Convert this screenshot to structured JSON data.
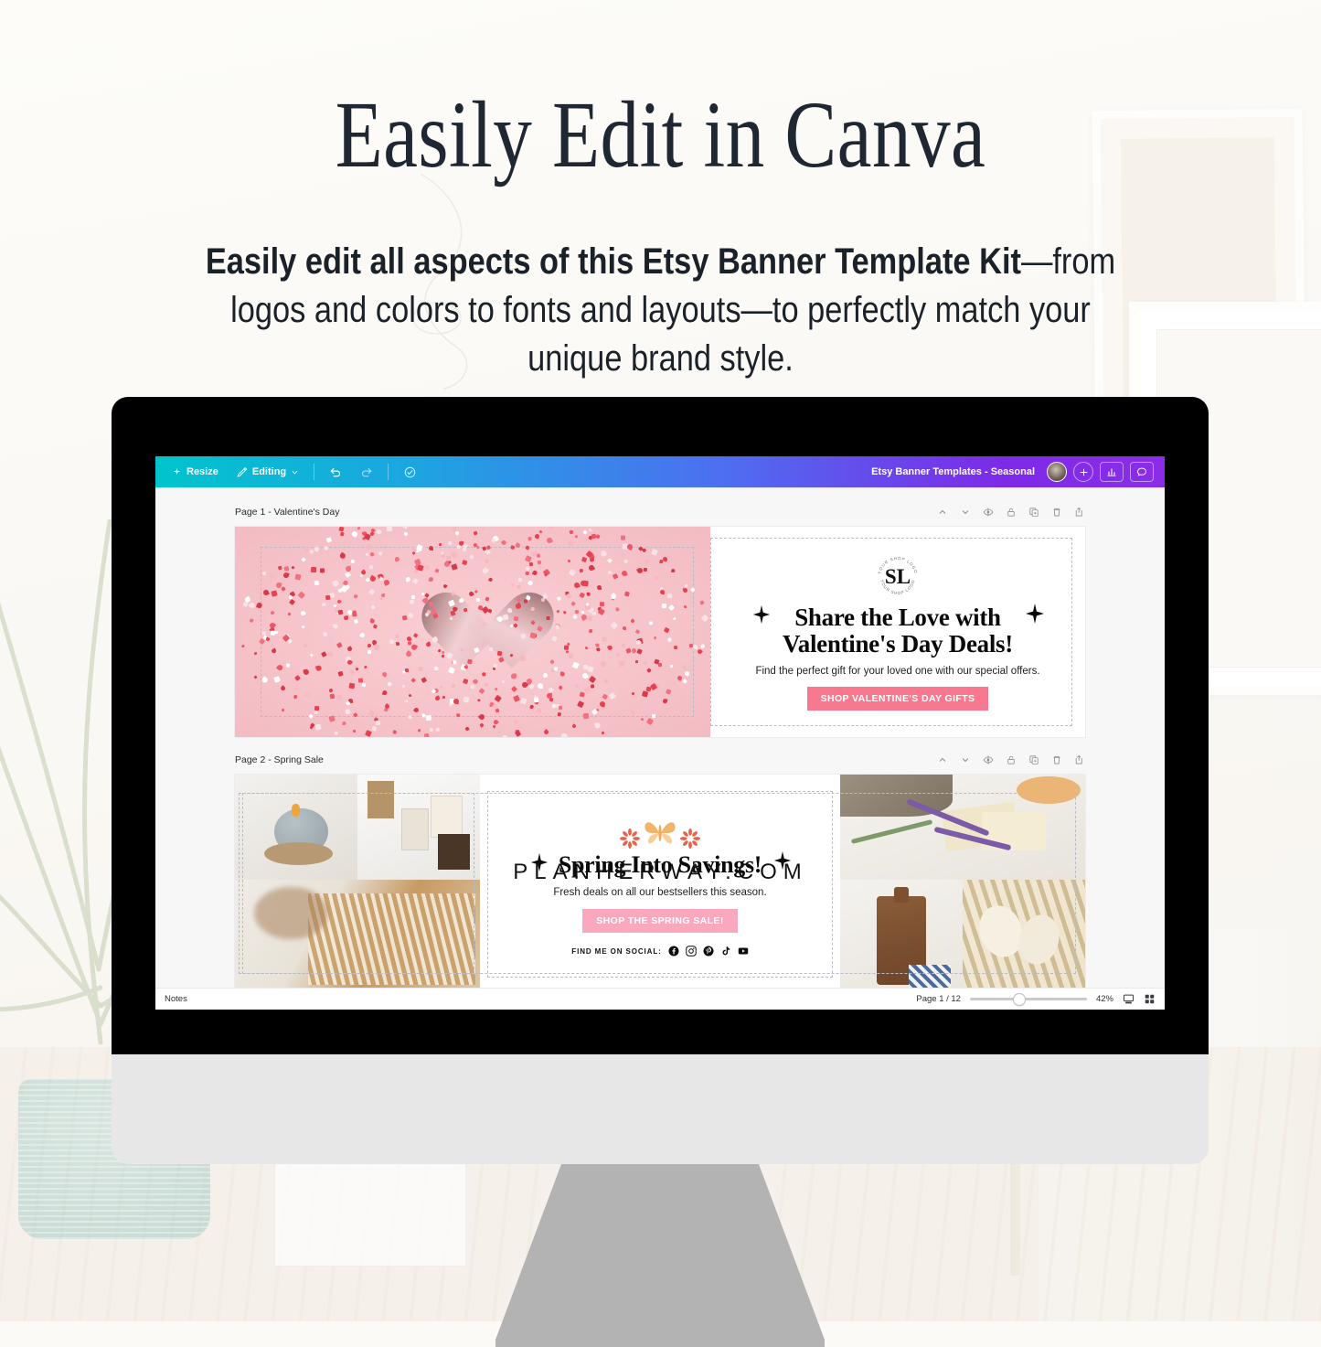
{
  "hero": {
    "headline": "Easily Edit in Canva",
    "subhead_bold": "Easily edit all aspects of this Etsy Banner Template Kit",
    "subhead_rest": "—from logos and colors to fonts and layouts—to perfectly match your unique brand style."
  },
  "footer": {
    "brand": "PLANHERWAY.COM"
  },
  "app": {
    "toolbar": {
      "resize_label": "Resize",
      "editing_label": "Editing",
      "undo_icon": "undo-icon",
      "redo_icon": "redo-icon",
      "cloud_icon": "cloud-saved-icon",
      "doc_title": "Etsy Banner Templates - Seasonal",
      "avatar_icon": "avatar",
      "add_icon": "add-collaborator-icon",
      "insights_icon": "insights-icon",
      "comment_icon": "comment-icon",
      "gradient_from": "#00c4cc",
      "gradient_to": "#8b2de8"
    },
    "page_tools": [
      "chevron-up-icon",
      "chevron-down-icon",
      "hide-eye-icon",
      "lock-icon",
      "duplicate-icon",
      "trash-icon",
      "expand-icon"
    ],
    "pages": [
      {
        "label": "Page 1 - Valentine's Day",
        "logo_initials": "SL",
        "logo_ring_text": "YOUR SHOP LOGO",
        "heading_line1": "Share the Love with",
        "heading_line2": "Valentine's Day Deals!",
        "subtext": "Find the perfect gift for your loved one with our special offers.",
        "cta": "SHOP VALENTINE'S DAY GIFTS",
        "cta_color": "#f8788f",
        "image_alt": "heart-dish-sprinkles-photo"
      },
      {
        "label": "Page 2 - Spring Sale",
        "heading": "Spring Into Savings!",
        "subtext": "Fresh deals on all our bestsellers this season.",
        "cta": "SHOP THE SPRING SALE!",
        "cta_color": "#f9a8bd",
        "social_label": "FIND ME ON SOCIAL:",
        "social_icons": [
          "facebook-icon",
          "instagram-icon",
          "pinterest-icon",
          "tiktok-icon",
          "youtube-icon"
        ],
        "photos_left": [
          "candle-concrete-photo",
          "candles-group-photo",
          "macrame-photo"
        ],
        "photos_right": [
          "lavender-soap-photo",
          "cutting-board-photo",
          "wooden-spoons-photo"
        ]
      }
    ],
    "statusbar": {
      "notes_label": "Notes",
      "page_indicator": "Page 1 / 12",
      "zoom_level": "42%",
      "presenter_icon": "presenter-view-icon",
      "grid_icon": "grid-view-icon"
    }
  }
}
